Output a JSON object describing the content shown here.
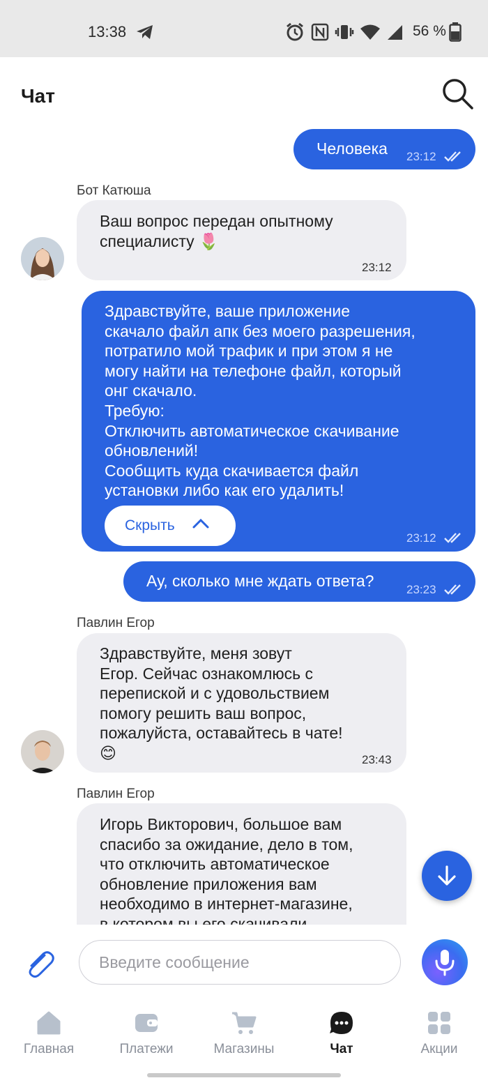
{
  "status_bar": {
    "time": "13:38",
    "battery": "56 %",
    "icons": [
      "telegram-icon",
      "alarm-icon",
      "nfc-icon",
      "vibrate-icon",
      "wifi-icon",
      "signal-icon",
      "battery-icon"
    ]
  },
  "header": {
    "title": "Чат"
  },
  "messages": [
    {
      "type": "outgoing",
      "text": "Человека",
      "time": "23:12",
      "read": true
    },
    {
      "type": "incoming",
      "sender": "Бот Катюша",
      "text": "Ваш вопрос передан опытному\nспециалисту 🌷",
      "time": "23:12"
    },
    {
      "type": "outgoing",
      "text": "Здравствуйте, ваше приложение\nскачало файл апк без моего разрешения,\nпотратило мой трафик и при этом я не\nмогу найти на телефоне файл, который\nонг скачало.\nТребую:\nОтключить автоматическое скачивание\nобновлений!\nСообщить куда скачивается файл\nустановки либо как его удалить!",
      "time": "23:12",
      "read": true,
      "collapse_label": "Скрыть"
    },
    {
      "type": "outgoing",
      "text": "Ау, сколько мне ждать ответа?",
      "time": "23:23",
      "read": true
    },
    {
      "type": "incoming",
      "sender": "Павлин Егор",
      "text": "Здравствуйте, меня зовут\nЕгор. Сейчас ознакомлюсь с\nперепиской и с удовольствием\nпомогу решить ваш вопрос,\nпожалуйста, оставайтесь в чате!\n😊",
      "time": "23:43"
    },
    {
      "type": "incoming",
      "sender": "Павлин Егор",
      "text": "Игорь Викторович, большое вам\nспасибо за ожидание, дело в том,\nчто отключить автоматическое\nобновление приложения вам\nнеобходимо в интернет-магазине,\nв котором вы его скачивали"
    }
  ],
  "input": {
    "placeholder": "Введите сообщение"
  },
  "nav": [
    {
      "label": "Главная",
      "icon": "home-icon"
    },
    {
      "label": "Платежи",
      "icon": "wallet-icon"
    },
    {
      "label": "Магазины",
      "icon": "cart-icon"
    },
    {
      "label": "Чат",
      "icon": "chat-icon",
      "active": true
    },
    {
      "label": "Акции",
      "icon": "grid-icon"
    }
  ],
  "colors": {
    "accent": "#2a63e0",
    "incoming_bubble": "#eeeef2",
    "nav_inactive": "#8a8f99"
  }
}
